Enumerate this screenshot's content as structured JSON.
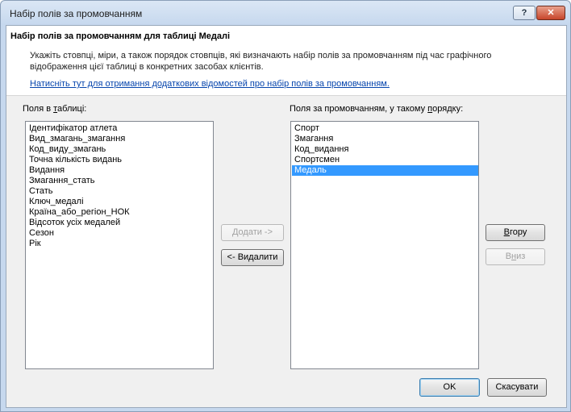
{
  "window": {
    "title": "Набір полів за промовчанням",
    "help_label": "?",
    "close_label": "✕"
  },
  "header": {
    "title": "Набір полів за промовчанням для таблиці Медалі",
    "description": "Укажіть стовпці, міри, а також порядок стовпців, які визначають  набір полів за промовчанням під час графічного відображення  цієї таблиці в конкретних засобах клієнтів.",
    "link": "Натисніть тут для отримання додаткових відомостей про набір полів за промовчанням."
  },
  "left_list": {
    "label_pre": "Поля в ",
    "label_accel": "т",
    "label_post": "аблиці:",
    "items": [
      "Ідентифікатор атлета",
      "Вид_змагань_змагання",
      "Код_виду_змагань",
      "Точна кількість видань",
      "Видання",
      "Змагання_стать",
      "Стать",
      "Ключ_медалі",
      "Країна_або_регіон_НОК",
      "Відсоток усіх медалей",
      "Сезон",
      "Рік"
    ]
  },
  "right_list": {
    "label_pre": "Поля за промовчанням, у такому ",
    "label_accel": "п",
    "label_post": "орядку:",
    "items": [
      "Спорт",
      "Змагання",
      "Код_видання",
      "Спортсмен",
      "Медаль"
    ],
    "selected_index": 4
  },
  "buttons": {
    "add": "Додати ->",
    "remove": "<- Видалити",
    "up_accel": "В",
    "up_rest": "гору",
    "down_pre": "В",
    "down_accel": "н",
    "down_post": "из",
    "ok": "OK",
    "cancel": "Скасувати"
  }
}
